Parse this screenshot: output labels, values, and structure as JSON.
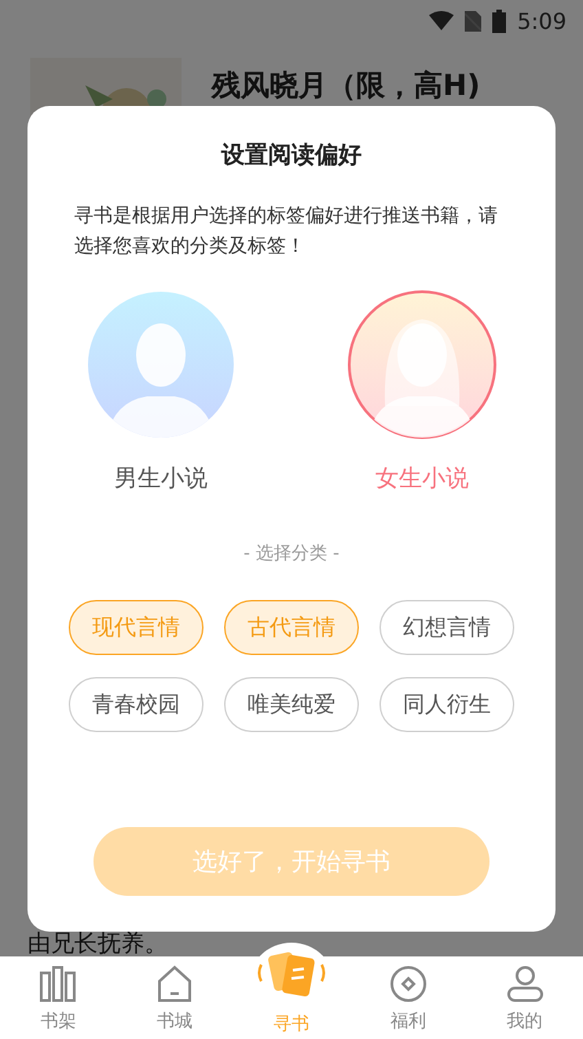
{
  "status_bar": {
    "time": "5:09"
  },
  "book": {
    "title": "残风晓月（限，高H)",
    "excerpt": "由兄长抚养。"
  },
  "dialog": {
    "title": "设置阅读偏好",
    "description": "寻书是根据用户选择的标签偏好进行推送书籍，请选择您喜欢的分类及标签！",
    "genders": [
      {
        "label": "男生小说",
        "kind": "male",
        "selected": false
      },
      {
        "label": "女生小说",
        "kind": "female",
        "selected": true
      }
    ],
    "section_label": "- 选择分类 -",
    "tags": [
      {
        "label": "现代言情",
        "selected": true
      },
      {
        "label": "古代言情",
        "selected": true
      },
      {
        "label": "幻想言情",
        "selected": false
      },
      {
        "label": "青春校园",
        "selected": false
      },
      {
        "label": "唯美纯爱",
        "selected": false
      },
      {
        "label": "同人衍生",
        "selected": false
      }
    ],
    "confirm_button": {
      "label": "选好了，开始寻书",
      "disabled": true
    }
  },
  "tab_bar": [
    {
      "label": "书架",
      "kind": "shelf",
      "selected": false
    },
    {
      "label": "书城",
      "kind": "home",
      "selected": false
    },
    {
      "label": "寻书",
      "kind": "cards",
      "selected": true
    },
    {
      "label": "福利",
      "kind": "coin",
      "selected": false
    },
    {
      "label": "我的",
      "kind": "user",
      "selected": false
    }
  ]
}
